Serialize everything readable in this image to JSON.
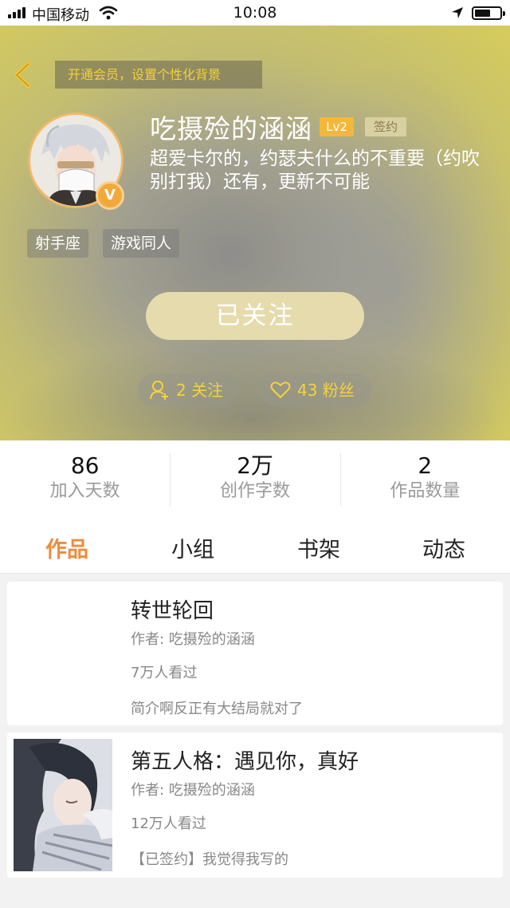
{
  "status_bar": {
    "carrier": "中国移动",
    "time": "10:08"
  },
  "header": {
    "vip_banner": "开通会员，设置个性化背景",
    "username": "吃摄殓的涵涵",
    "level_badge": "Lv2",
    "sign_badge": "签约",
    "bio": "超爱卡尔的，约瑟夫什么的不重要（约吹别打我）还有，更新不可能",
    "verified_mark": "V",
    "tags": [
      "射手座",
      "游戏同人"
    ],
    "follow_button": "已关注",
    "following": "2 关注",
    "fans": "43 粉丝"
  },
  "stats": [
    {
      "value": "86",
      "label": "加入天数"
    },
    {
      "value": "2万",
      "label": "创作字数"
    },
    {
      "value": "2",
      "label": "作品数量"
    }
  ],
  "tabs": [
    "作品",
    "小组",
    "书架",
    "动态"
  ],
  "active_tab": "作品",
  "books": [
    {
      "title": "转世轮回",
      "author": "作者: 吃摄殓的涵涵",
      "views": "7万人看过",
      "desc": "简介啊反正有大结局就对了"
    },
    {
      "title": "第五人格：遇见你，真好",
      "author": "作者: 吃摄殓的涵涵",
      "views": "12万人看过",
      "desc": "【已签约】我觉得我写的"
    }
  ],
  "colors": {
    "accent": "#f08b3c",
    "level_badge": "#f3b83a",
    "highlight_text": "#f4d23e",
    "follow_button": "#e5dbac"
  },
  "icons": [
    "signal-icon",
    "wifi-icon",
    "location-icon",
    "battery-icon",
    "back-chevron-icon",
    "verified-icon",
    "add-user-icon",
    "heart-icon"
  ]
}
